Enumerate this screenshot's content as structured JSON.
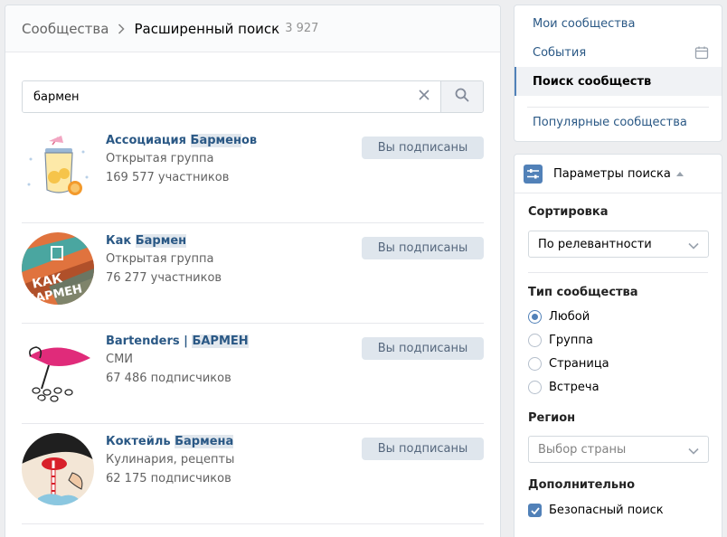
{
  "colors": {
    "accent": "#5181b8",
    "link": "#2a5885",
    "button_bg": "#dfe6ed",
    "button_text": "#55677d",
    "page_bg": "#edeef0"
  },
  "breadcrumb": {
    "root": "Сообщества",
    "current": "Расширенный поиск",
    "count": "3 927",
    "separator_icon": "chevron-right-icon"
  },
  "search": {
    "value": "бармен",
    "clear_icon": "close-icon",
    "search_icon": "search-icon"
  },
  "results": [
    {
      "name_before": "Ассоциация ",
      "name_highlight": "Бармен",
      "name_after": "ов",
      "type": "Открытая группа",
      "members": "169 577 участников",
      "button": "Вы подписаны",
      "avatar": "cocktail-jar-illustration"
    },
    {
      "name_before": "Как ",
      "name_highlight": "Бармен",
      "name_after": "",
      "type": "Открытая группа",
      "members": "76 277 участников",
      "button": "Вы подписаны",
      "avatar": "kak-barmen-logo"
    },
    {
      "name_before": "Bartenders | ",
      "name_highlight": "БАРМЕН",
      "name_after": "",
      "type": "СМИ",
      "members": "67 486 подписчиков",
      "button": "Вы подписаны",
      "avatar": "cocktail-glass-sketch"
    },
    {
      "name_before": "Коктейль ",
      "name_highlight": "Бармена",
      "name_after": "",
      "type": "Кулинария, рецепты",
      "members": "62 175 подписчиков",
      "button": "Вы подписаны",
      "avatar": "drinking-straw-illustration"
    }
  ],
  "menu": {
    "items": [
      "Мои сообщества",
      "События",
      "Поиск сообществ",
      "Популярные сообщества"
    ],
    "active_index": 2,
    "events_icon": "calendar-icon"
  },
  "filters": {
    "header": "Параметры поиска",
    "header_icon": "sliders-icon",
    "sort_label": "Сортировка",
    "sort_value": "По релевантности",
    "type_label": "Тип сообщества",
    "type_options": [
      "Любой",
      "Группа",
      "Страница",
      "Встреча"
    ],
    "type_selected": 0,
    "region_label": "Регион",
    "region_placeholder": "Выбор страны",
    "extra_label": "Дополнительно",
    "safe_search_label": "Безопасный поиск",
    "safe_search_checked": true
  }
}
